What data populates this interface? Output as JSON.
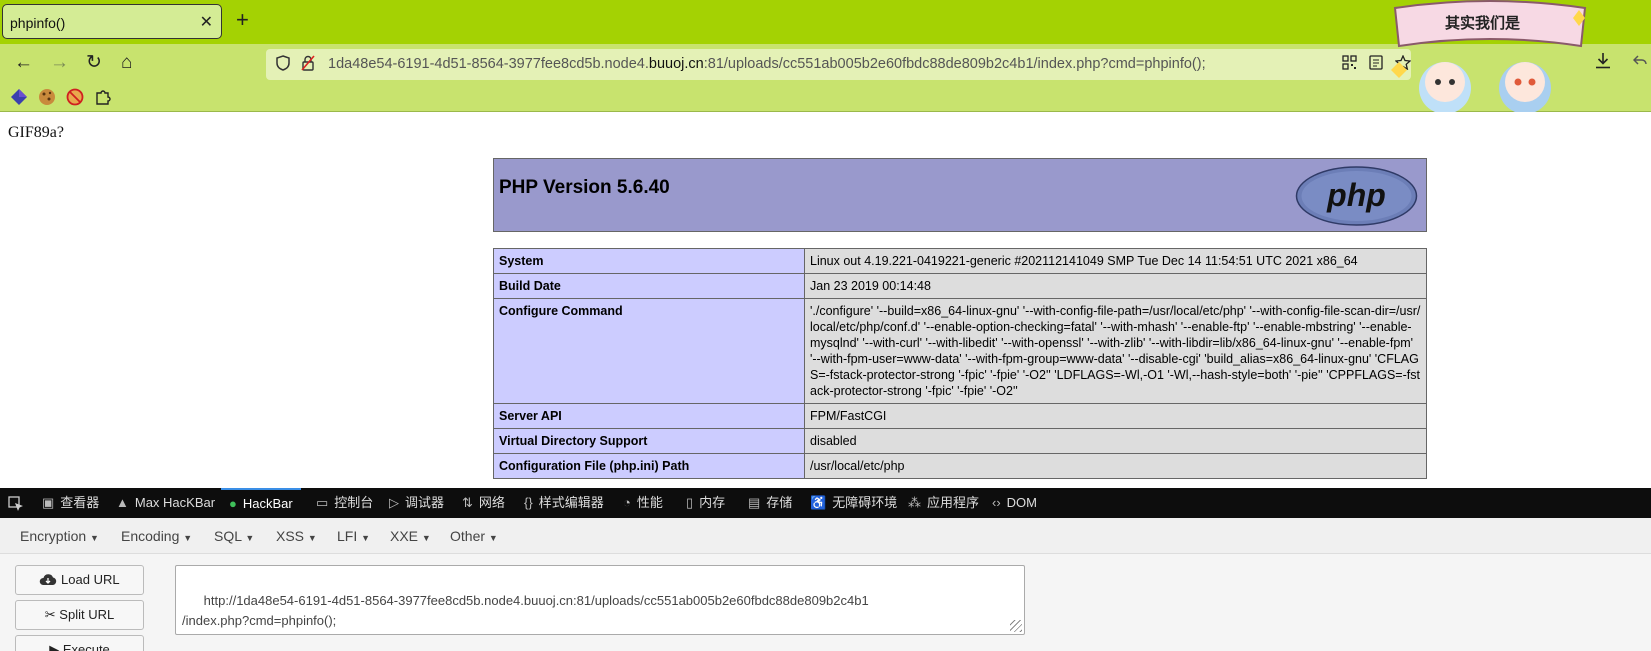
{
  "browser": {
    "tab_title": "phpinfo()",
    "tab_close": "✕",
    "new_tab": "+",
    "url_prefix": "1da48e54-6191-4d51-8564-3977fee8cd5b.node4.",
    "url_domain": "buuoj.cn",
    "url_suffix": ":81/uploads/cc551ab005b2e60fbdc88de809b2c4b1/index.php?cmd=phpinfo();",
    "nav": {
      "back": "←",
      "forward": "→",
      "reload": "↻",
      "home": "⌂"
    },
    "banner_text": "其实我们是"
  },
  "page": {
    "gif_header": "GIF89a?",
    "php_version": "PHP Version 5.6.40",
    "php_logo_text": "php",
    "rows": [
      {
        "label": "System",
        "value": "Linux out 4.19.221-0419221-generic #202112141049 SMP Tue Dec 14 11:54:51 UTC 2021 x86_64"
      },
      {
        "label": "Build Date",
        "value": "Jan 23 2019 00:14:48"
      },
      {
        "label": "Configure Command",
        "value": "'./configure' '--build=x86_64-linux-gnu' '--with-config-file-path=/usr/local/etc/php' '--with-config-file-scan-dir=/usr/local/etc/php/conf.d' '--enable-option-checking=fatal' '--with-mhash' '--enable-ftp' '--enable-mbstring' '--enable-mysqlnd' '--with-curl' '--with-libedit' '--with-openssl' '--with-zlib' '--with-libdir=lib/x86_64-linux-gnu' '--enable-fpm' '--with-fpm-user=www-data' '--with-fpm-group=www-data' '--disable-cgi' 'build_alias=x86_64-linux-gnu' 'CFLAGS=-fstack-protector-strong '-fpic' '-fpie' '-O2'' 'LDFLAGS=-Wl,-O1 '-Wl,--hash-style=both' '-pie'' 'CPPFLAGS=-fstack-protector-strong '-fpic' '-fpie' '-O2''"
      },
      {
        "label": "Server API",
        "value": "FPM/FastCGI"
      },
      {
        "label": "Virtual Directory Support",
        "value": "disabled"
      },
      {
        "label": "Configuration File (php.ini) Path",
        "value": "/usr/local/etc/php"
      }
    ]
  },
  "devtools": {
    "tabs": [
      "查看器",
      "Max HacKBar",
      "HackBar",
      "控制台",
      "调试器",
      "网络",
      "样式编辑器",
      "性能",
      "内存",
      "存储",
      "无障碍环境",
      "应用程序",
      "DOM"
    ]
  },
  "hackbar": {
    "menu": [
      "Encryption",
      "Encoding",
      "SQL",
      "XSS",
      "LFI",
      "XXE",
      "Other"
    ],
    "load_url": "Load URL",
    "split_url": "Split URL",
    "execute": "Execute",
    "url_text": "http://1da48e54-6191-4d51-8564-3977fee8cd5b.node4.buuoj.cn:81/uploads/cc551ab005b2e60fbdc88de809b2c4b1\n/index.php?cmd=phpinfo();"
  },
  "colors": {
    "tabstrip": "#a4d203",
    "toolbar": "#c8e36e",
    "php_header": "#9999cc",
    "label_cell": "#ccccff",
    "value_cell": "#dddddd"
  }
}
